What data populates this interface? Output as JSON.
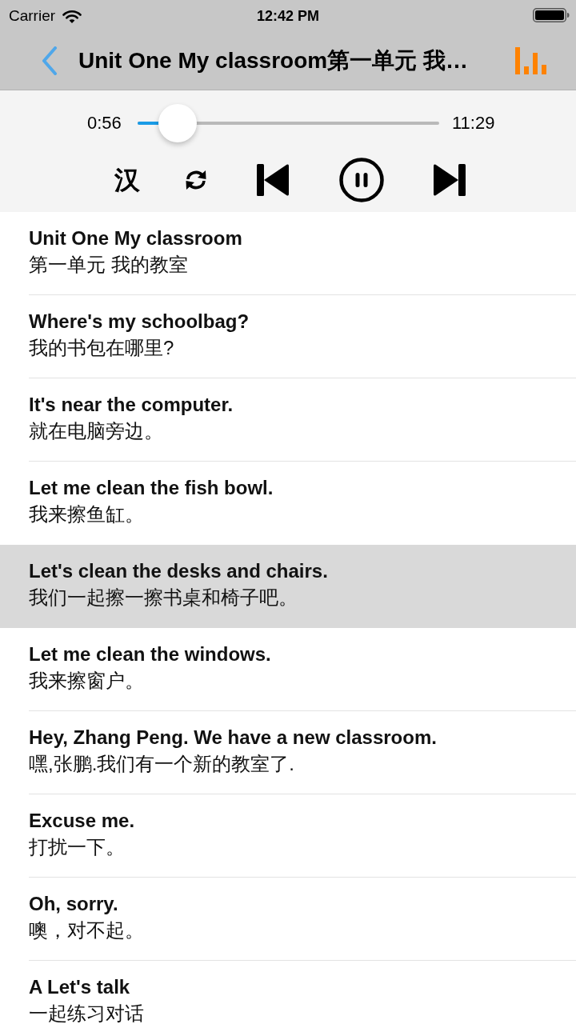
{
  "status_bar": {
    "carrier": "Carrier",
    "time": "12:42 PM"
  },
  "nav_bar": {
    "title": "Unit One My classroom第一单元 我…"
  },
  "player": {
    "elapsed": "0:56",
    "duration": "11:29",
    "progress": {
      "level": 0.08
    },
    "translation_toggle": "汉",
    "playing": true
  },
  "sentences": [
    {
      "english": "Unit One My classroom",
      "chinese": "第一单元 我的教室",
      "selected": false
    },
    {
      "english": "Where's my schoolbag?",
      "chinese": "我的书包在哪里?",
      "selected": false
    },
    {
      "english": "It's near the computer.",
      "chinese": "就在电脑旁边。",
      "selected": false
    },
    {
      "english": "Let me clean the fish bowl.",
      "chinese": "我来擦鱼缸。",
      "selected": false
    },
    {
      "english": "Let's clean the desks and chairs.",
      "chinese": "我们一起擦一擦书桌和椅子吧。",
      "selected": true
    },
    {
      "english": "Let me clean the windows.",
      "chinese": "我来擦窗户。",
      "selected": false
    },
    {
      "english": "Hey, Zhang Peng. We have a new classroom.",
      "chinese": "嘿,张鹏.我们有一个新的教室了.",
      "selected": false
    },
    {
      "english": "Excuse me.",
      "chinese": "打扰一下。",
      "selected": false
    },
    {
      "english": "Oh, sorry.",
      "chinese": "噢，对不起。",
      "selected": false
    },
    {
      "english": "A Let's talk",
      "chinese": "一起练习对话",
      "selected": false
    }
  ]
}
